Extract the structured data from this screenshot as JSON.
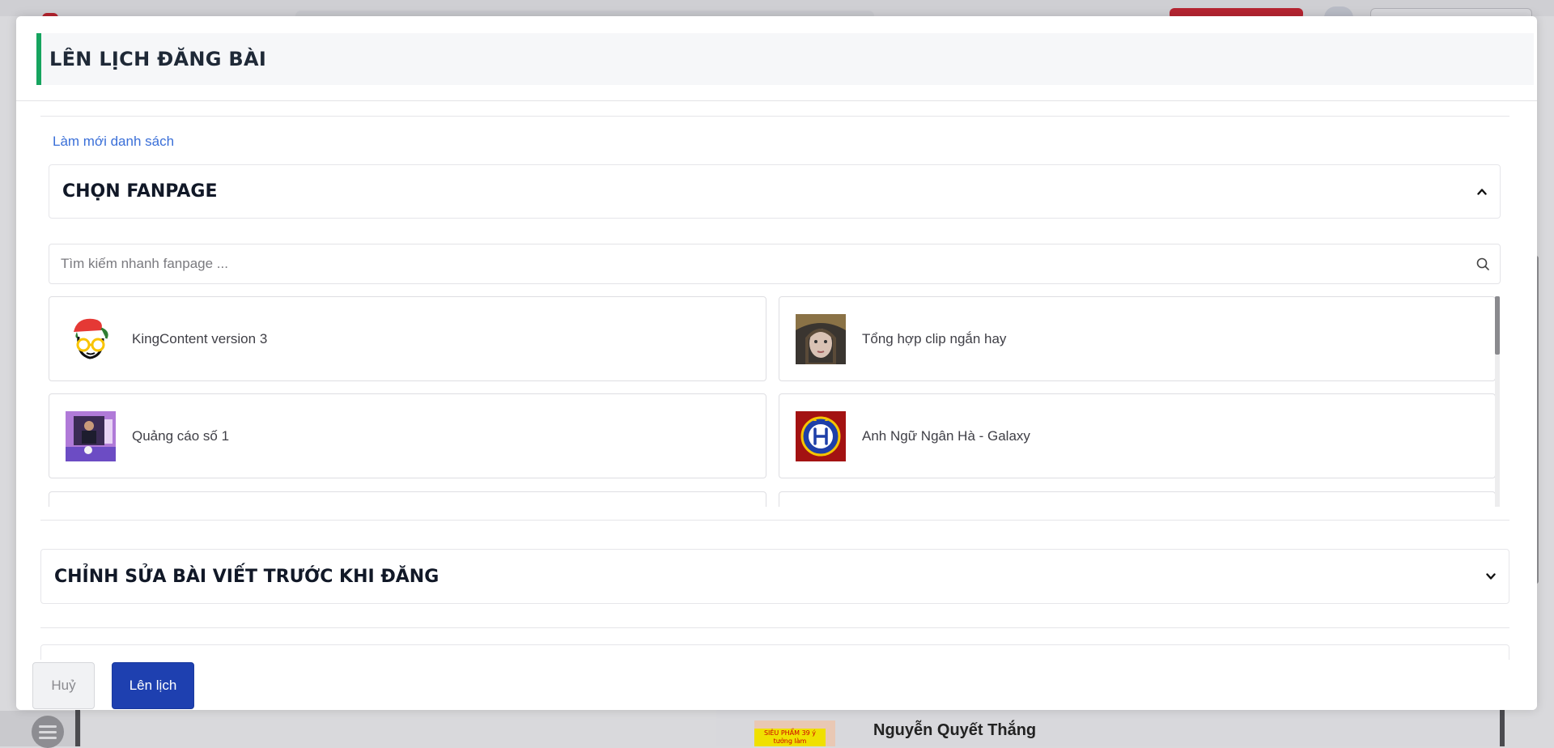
{
  "background": {
    "card_name": "Nguyễn Quyết Thắng",
    "thumb_text": "SIÊU PHẨM 39 ý tưởng làm"
  },
  "modal": {
    "title": "LÊN LỊCH ĐĂNG BÀI",
    "refresh_link": "Làm mới danh sách",
    "fanpage_section": {
      "title": "CHỌN FANPAGE",
      "search_placeholder": "Tìm kiếm nhanh fanpage ...",
      "pages": [
        {
          "name": "KingContent version 3",
          "avatar": "kingcontent-avatar"
        },
        {
          "name": "Tổng hợp clip ngắn hay",
          "avatar": "clip-avatar"
        },
        {
          "name": "Quảng cáo số 1",
          "avatar": "quangcao-avatar"
        },
        {
          "name": "Anh Ngữ Ngân Hà - Galaxy",
          "avatar": "galaxy-avatar"
        }
      ]
    },
    "edit_section": {
      "title": "CHỈNH SỬA BÀI VIẾT TRƯỚC KHI ĐĂNG"
    },
    "footer": {
      "cancel_label": "Huỷ",
      "schedule_label": "Lên lịch"
    }
  },
  "colors": {
    "accent_green": "#16a45f",
    "primary_blue": "#1e40b0",
    "link_blue": "#3a6fd8"
  }
}
